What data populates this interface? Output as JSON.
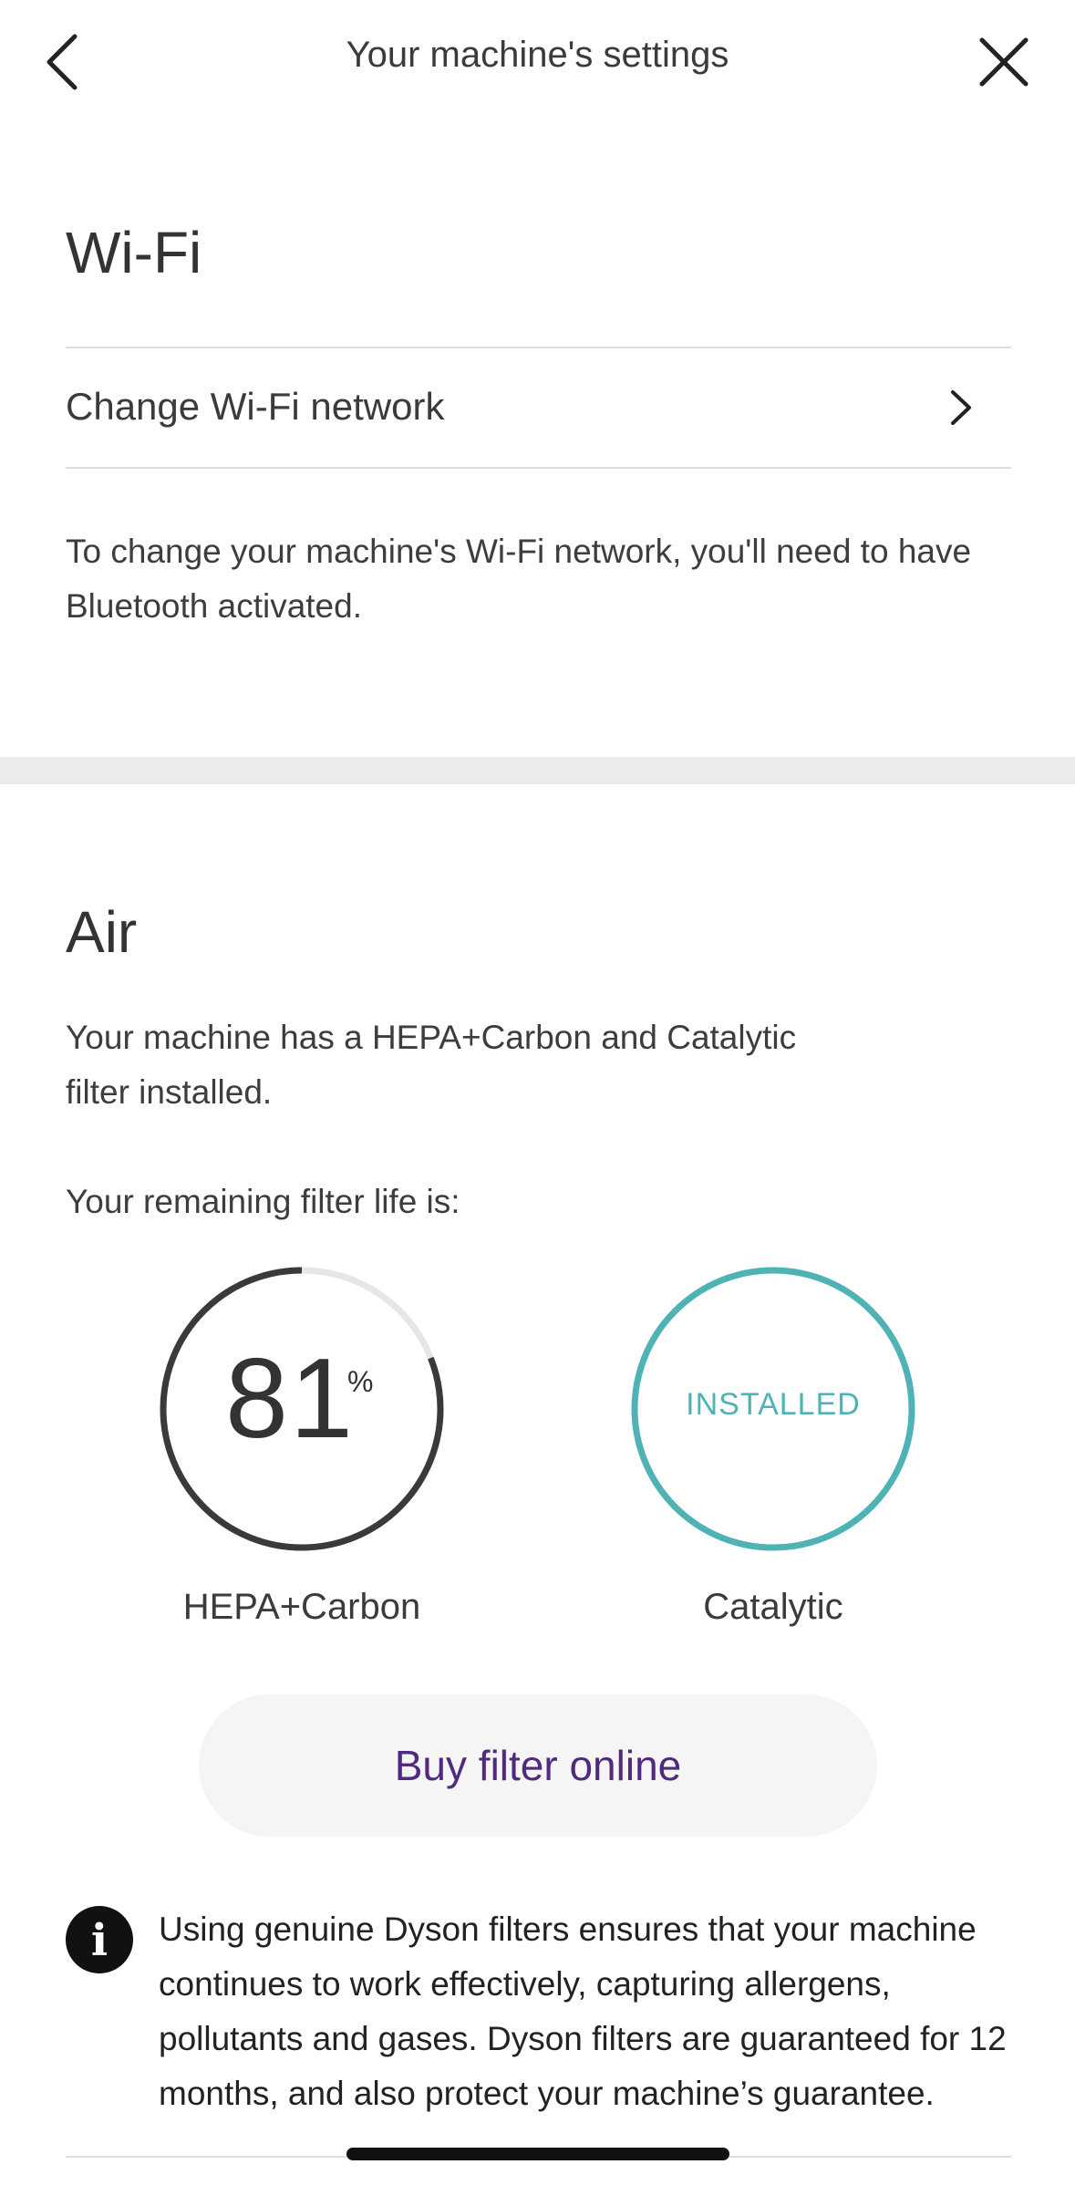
{
  "header": {
    "title": "Your machine's settings",
    "back_icon": "chevron-left-icon",
    "close_icon": "close-icon"
  },
  "wifi": {
    "heading": "Wi-Fi",
    "change_network_label": "Change Wi-Fi network",
    "help_line1": "To change your machine's Wi-Fi network, you'll need to have",
    "help_line2": "Bluetooth activated."
  },
  "air": {
    "heading": "Air",
    "description_line1": "Your machine has a HEPA+Carbon and Catalytic",
    "description_line2": "filter installed.",
    "remaining_label": "Your remaining filter life is:",
    "filters": [
      {
        "name": "HEPA+Carbon",
        "value": "81",
        "unit": "%",
        "life_fraction": 0.81
      },
      {
        "name": "Catalytic",
        "status": "INSTALLED"
      }
    ],
    "buy_button_label": "Buy filter online",
    "info_line1": "Using genuine Dyson filters ensures that your machine",
    "info_line2": "continues to work effectively, capturing allergens,",
    "info_line3": "pollutants and gases. Dyson filters are guaranteed for 12",
    "info_line4": "months, and also protect your machine’s guarantee.",
    "info_icon_glyph": "i"
  },
  "colors": {
    "gauge_ring": "#3a3a3a",
    "gauge_track": "#e6e6e6",
    "installed_teal": "#4fb3b6",
    "button_text_purple": "#4f2a7f",
    "button_bg": "#f5f5f5",
    "section_band": "#ebebeb"
  }
}
